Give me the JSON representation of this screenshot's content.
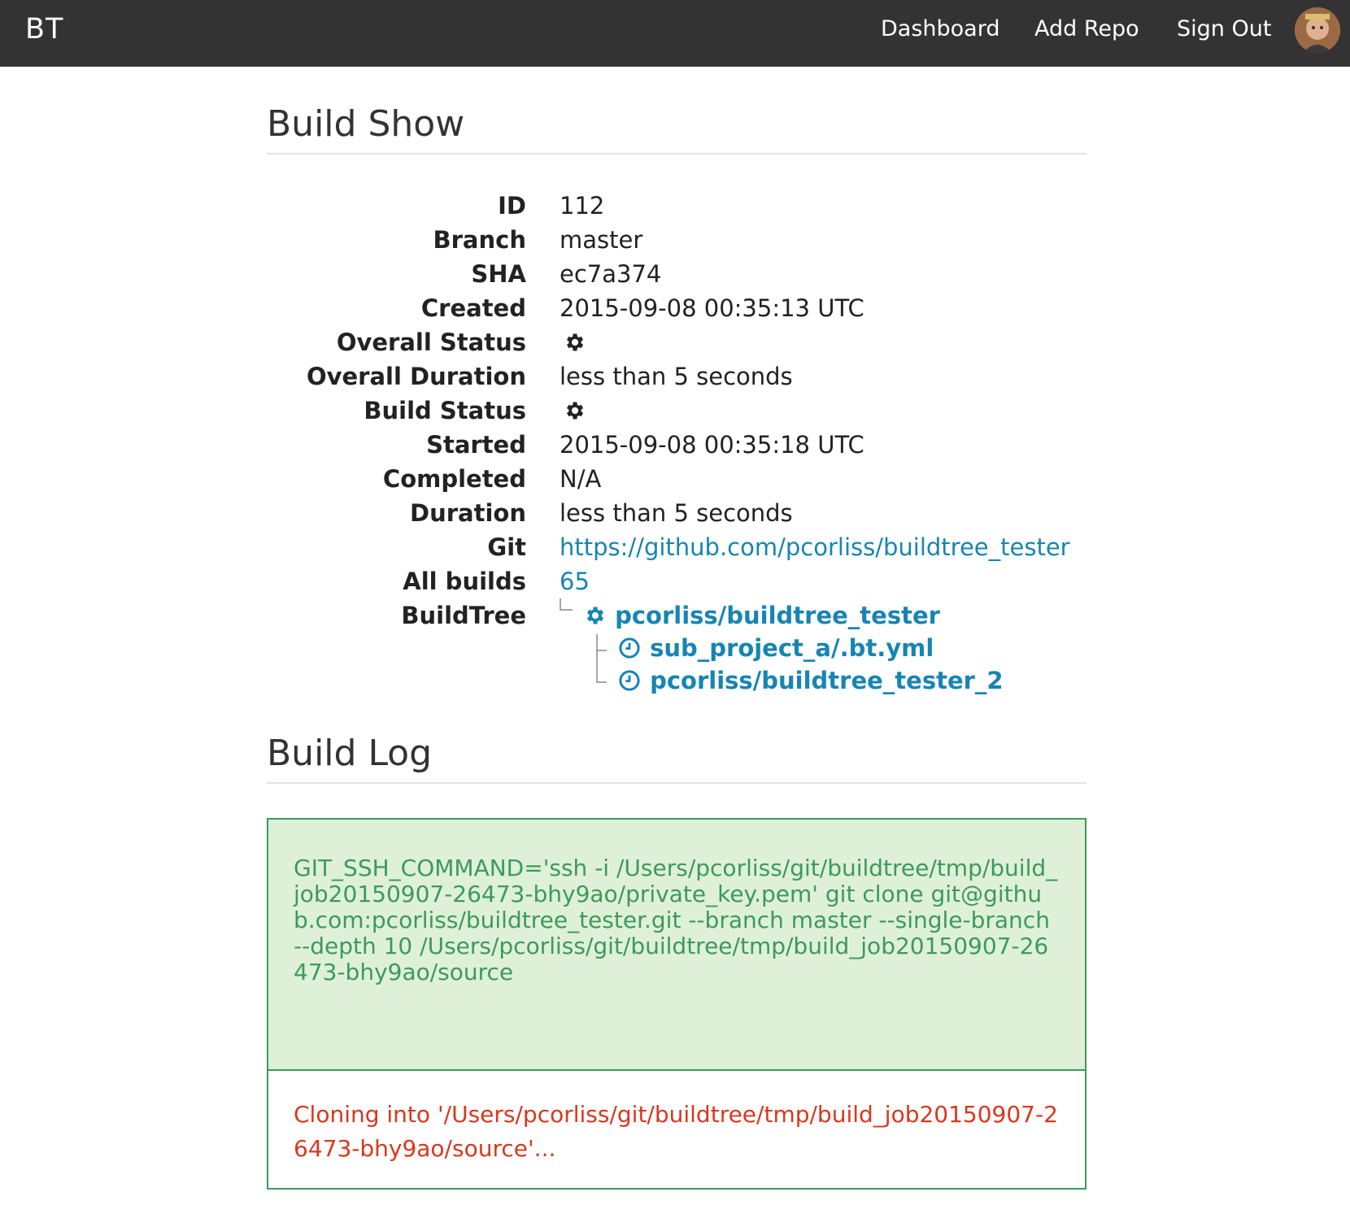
{
  "nav": {
    "brand": "BT",
    "dashboard": "Dashboard",
    "add_repo": "Add Repo",
    "sign_out": "Sign Out"
  },
  "build_show": {
    "title": "Build Show",
    "fields": {
      "id_label": "ID",
      "id": "112",
      "branch_label": "Branch",
      "branch": "master",
      "sha_label": "SHA",
      "sha": "ec7a374",
      "created_label": "Created",
      "created": "2015-09-08 00:35:13 UTC",
      "overall_status_label": "Overall Status",
      "overall_status_icon": "gear-icon",
      "overall_duration_label": "Overall Duration",
      "overall_duration": "less than 5 seconds",
      "build_status_label": "Build Status",
      "build_status_icon": "gear-icon",
      "started_label": "Started",
      "started": "2015-09-08 00:35:18 UTC",
      "completed_label": "Completed",
      "completed": "N/A",
      "duration_label": "Duration",
      "duration": "less than 5 seconds",
      "git_label": "Git",
      "git": "https://github.com/pcorliss/buildtree_tester",
      "all_builds_label": "All builds",
      "all_builds": "65",
      "buildtree_label": "BuildTree"
    },
    "tree": {
      "root": {
        "label": "pcorliss/buildtree_tester",
        "icon": "gear-icon"
      },
      "children": [
        {
          "label": "sub_project_a/.bt.yml",
          "icon": "clock-icon"
        },
        {
          "label": "pcorliss/buildtree_tester_2",
          "icon": "clock-icon"
        }
      ]
    }
  },
  "build_log": {
    "title": "Build Log",
    "command": "GIT_SSH_COMMAND='ssh -i /Users/pcorliss/git/buildtree/tmp/build_job20150907-26473-bhy9ao/private_key.pem' git clone git@github.com:pcorliss/buildtree_tester.git --branch master --single-branch --depth 10 /Users/pcorliss/git/buildtree/tmp/build_job20150907-26473-bhy9ao/source",
    "output": "Cloning into '/Users/pcorliss/git/buildtree/tmp/build_job20150907-26473-bhy9ao/source'..."
  },
  "colors": {
    "navbar": "#333333",
    "link": "#1785b3",
    "log_success_bg": "#dff0d8",
    "log_success_text": "#3c9a5c",
    "log_error_text": "#d9381e"
  }
}
